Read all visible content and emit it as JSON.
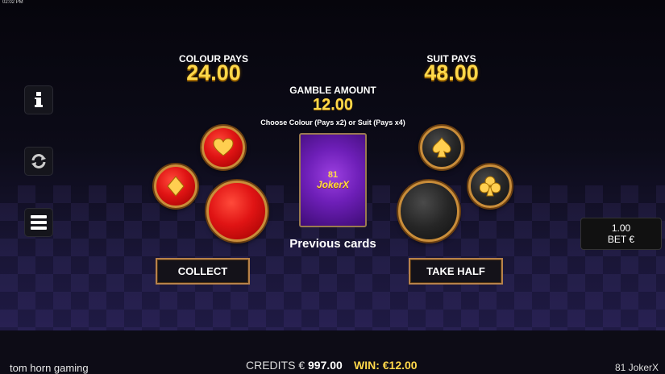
{
  "status": {
    "clock": "02:02 PM"
  },
  "colour_pays": {
    "label": "COLOUR PAYS",
    "value": "24.00"
  },
  "suit_pays": {
    "label": "SUIT PAYS",
    "value": "48.00"
  },
  "gamble": {
    "label": "GAMBLE AMOUNT",
    "value": "12.00",
    "instruction": "Choose Colour (Pays x2) or Suit (Pays x4)"
  },
  "card": {
    "logo_number": "81",
    "logo_text": "JokerX"
  },
  "previous_cards_label": "Previous cards",
  "buttons": {
    "collect": "COLLECT",
    "take_half": "TAKE HALF"
  },
  "side_menu": [
    "info-icon",
    "autoplay-icon",
    "menu-icon"
  ],
  "bet": {
    "value": "1.00",
    "label": "BET €"
  },
  "footer": {
    "brand": "tom horn gaming",
    "credits_label": "CREDITS €",
    "credits_value": "997.00",
    "win": "WIN: €12.00",
    "game_name": "81 JokerX"
  },
  "colors": {
    "red": "#e01414",
    "black": "#262626",
    "gold": "#ffd84a",
    "rim": "#c98d3a"
  }
}
